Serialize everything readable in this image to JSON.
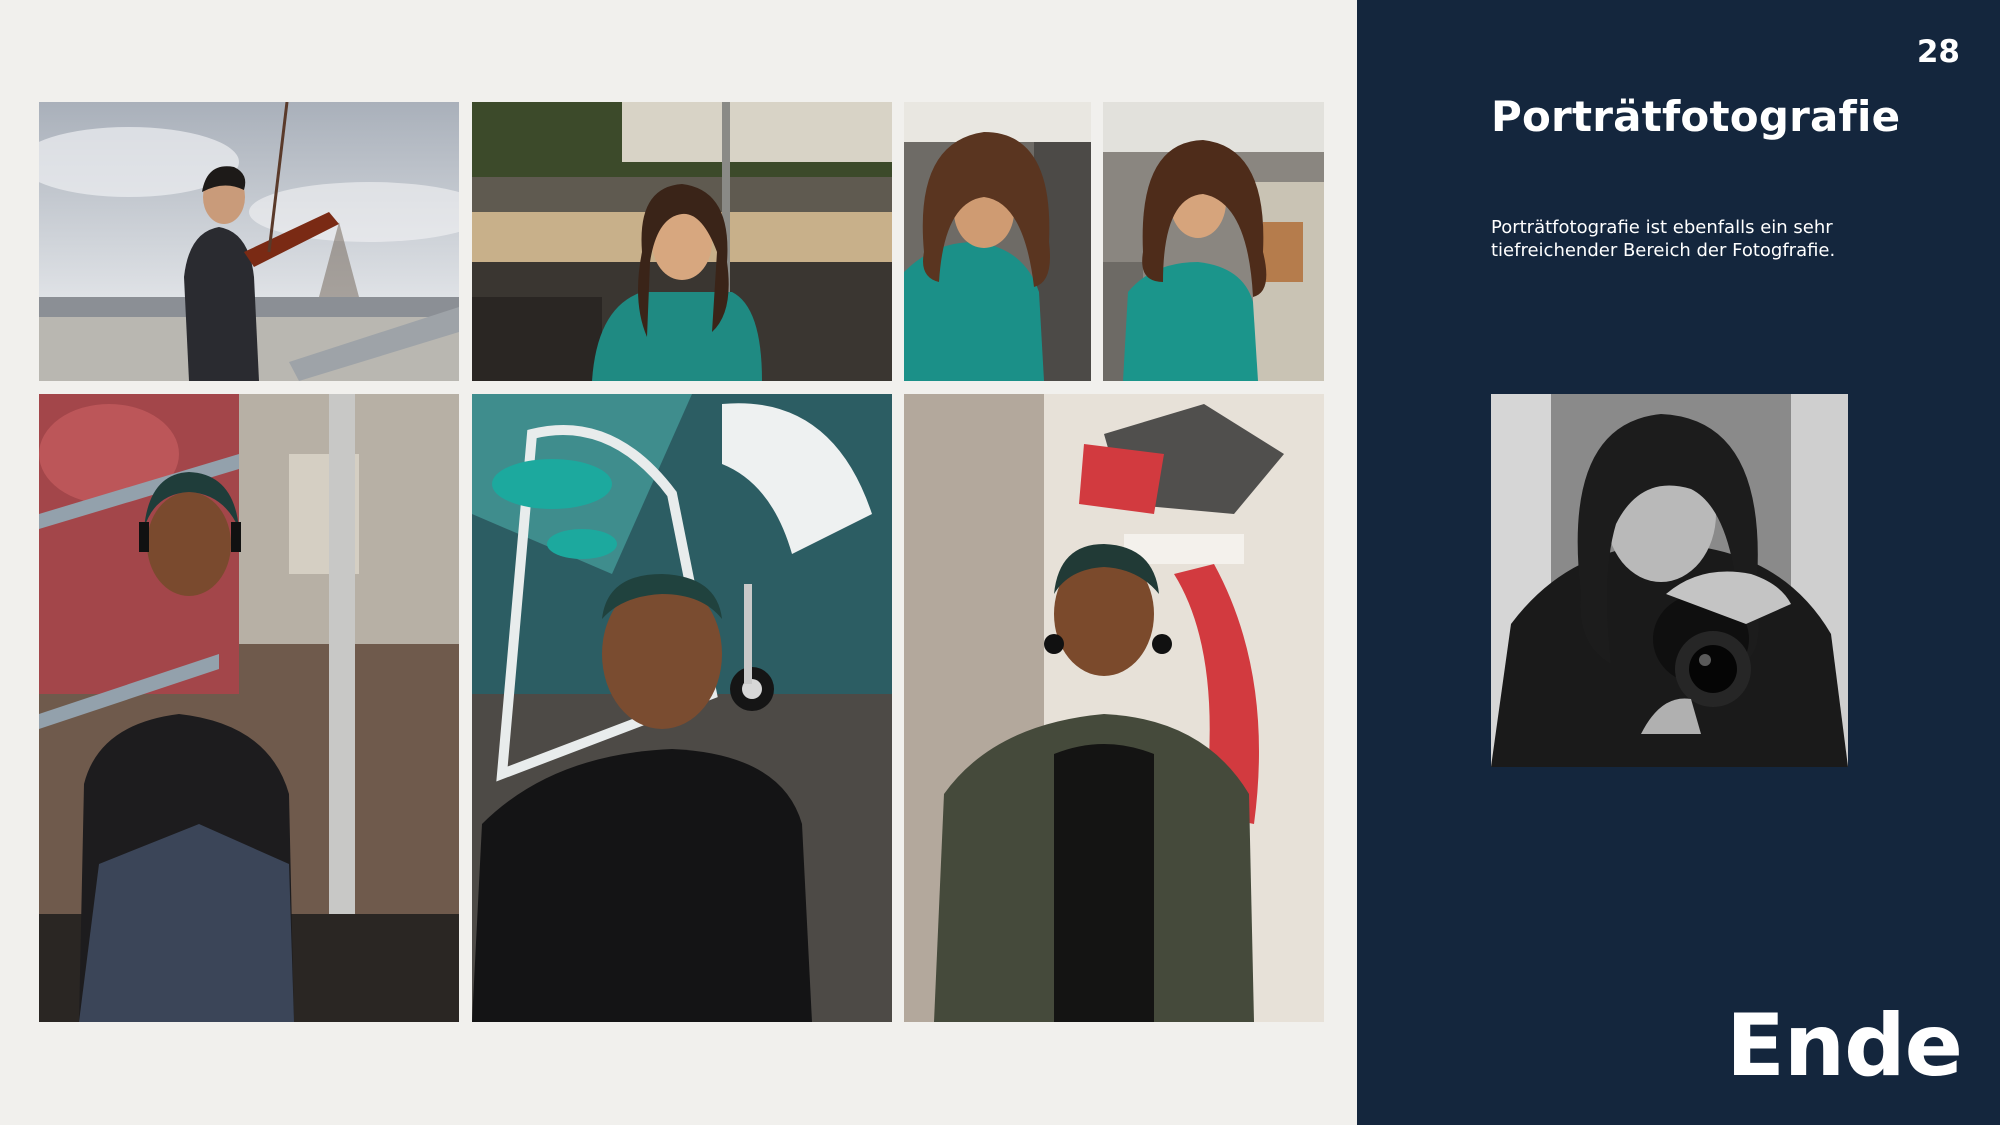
{
  "slide": {
    "page_number": "28",
    "title": "Porträtfotografie",
    "description": "Porträtfotografie ist ebenfalls ein sehr tiefreichender Bereich der Fotogfrafie.",
    "end_label": "Ende"
  },
  "colors": {
    "background": "#f1f0ed",
    "sidebar": "#14263d",
    "text": "#ffffff"
  },
  "gallery": [
    {
      "subject": "violinist-rooftop"
    },
    {
      "subject": "woman-station-seated"
    },
    {
      "subject": "woman-looking-down"
    },
    {
      "subject": "woman-station-standing"
    },
    {
      "subject": "man-sitting-graffiti-stairs"
    },
    {
      "subject": "man-headphones-graffiti-wall"
    },
    {
      "subject": "man-jacket-graffiti-pillar"
    },
    {
      "subject": "woman-camera-bw"
    }
  ]
}
